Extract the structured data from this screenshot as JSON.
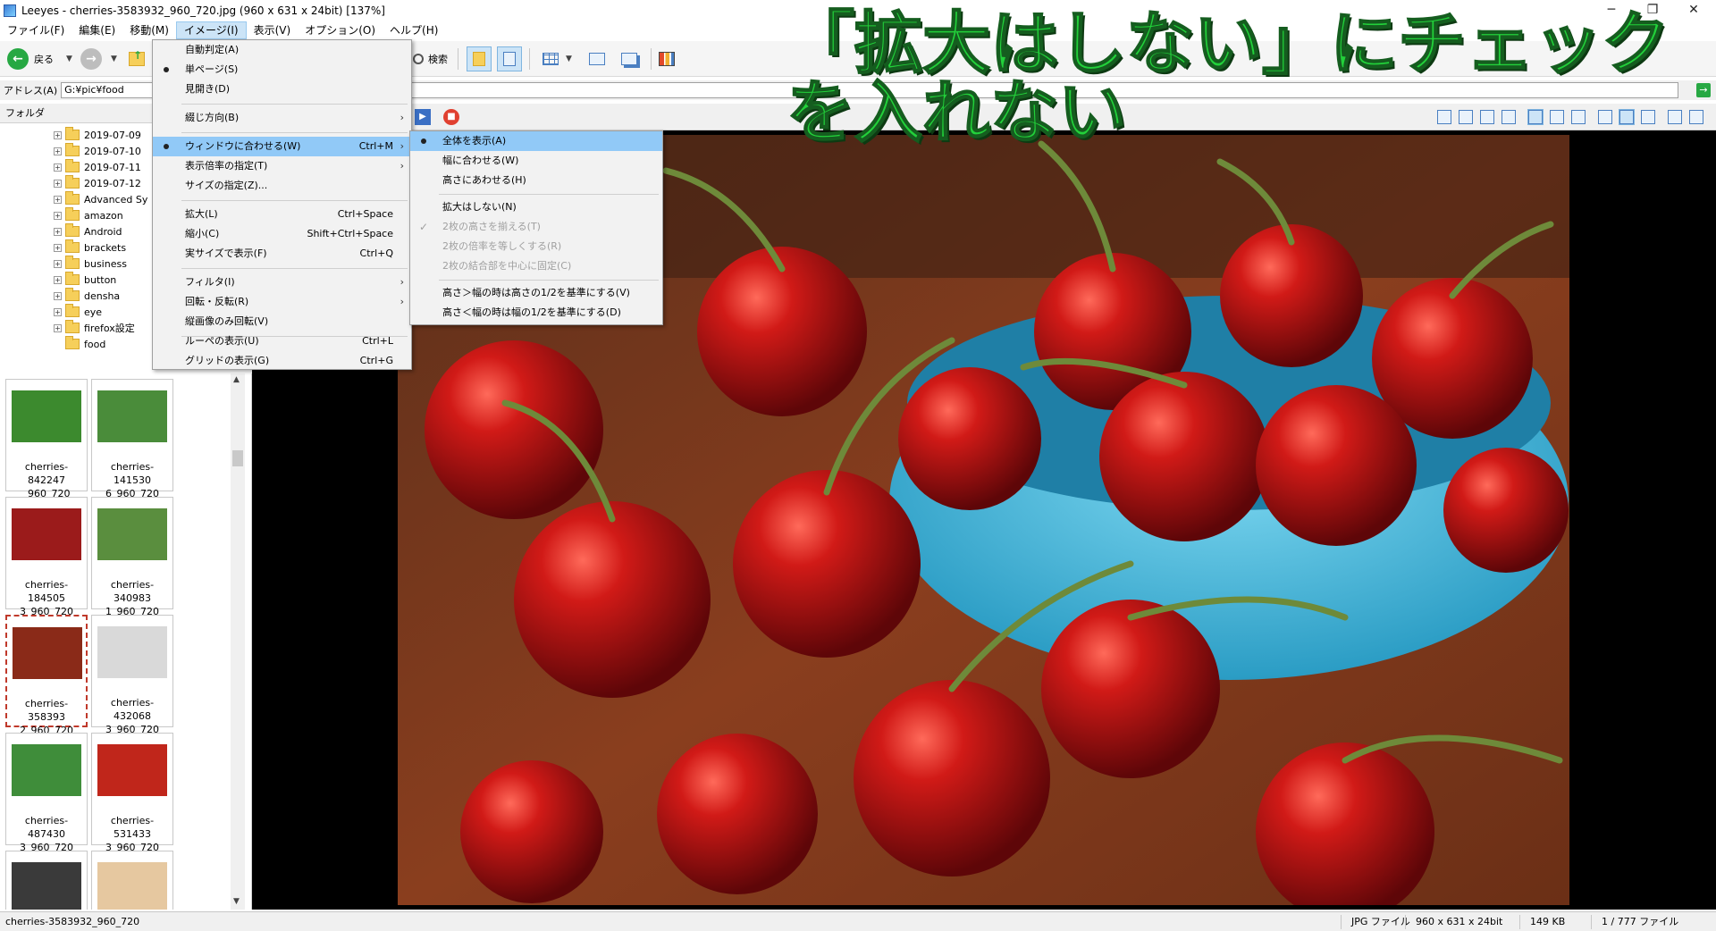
{
  "window": {
    "title": "Leeyes - cherries-3583932_960_720.jpg (960 x 631 x 24bit) [137%]",
    "minimize": "─",
    "maximize": "❐",
    "close": "✕"
  },
  "menubar": [
    "ファイル(F)",
    "編集(E)",
    "移動(M)",
    "イメージ(I)",
    "表示(V)",
    "オプション(O)",
    "ヘルプ(H)"
  ],
  "toolbar": {
    "back_label": "戻る",
    "search_label": "検索"
  },
  "address": {
    "label": "アドレス(A)",
    "value": "G:¥pic¥food"
  },
  "folder_pane": {
    "header": "フォルダ",
    "items": [
      "2019-07-09",
      "2019-07-10",
      "2019-07-11",
      "2019-07-12",
      "Advanced Sy",
      "amazon",
      "Android",
      "brackets",
      "business",
      "button",
      "densha",
      "eye",
      "firefox設定",
      "food"
    ]
  },
  "thumbnails": [
    {
      "label1": "cherries-842247",
      "label2": "_960_720",
      "color": "#3c8a2e"
    },
    {
      "label1": "cherries-141530",
      "label2": "6_960_720",
      "color": "#4a8c3a"
    },
    {
      "label1": "cherries-184505",
      "label2": "3_960_720",
      "color": "#9b1b1b"
    },
    {
      "label1": "cherries-340983",
      "label2": "1_960_720",
      "color": "#5a8e3e"
    },
    {
      "label1": "cherries-358393",
      "label2": "2_960_720",
      "color": "#8a2a18"
    },
    {
      "label1": "cherries-432068",
      "label2": "3_960_720",
      "color": "#d9d9d9"
    },
    {
      "label1": "cherries-487430",
      "label2": "3_960_720",
      "color": "#3f8d3a"
    },
    {
      "label1": "cherries-531433",
      "label2": "3_960_720",
      "color": "#c0261b"
    },
    {
      "label1": "",
      "label2": "",
      "color": "#3a3a3a"
    },
    {
      "label1": "",
      "label2": "",
      "color": "#e6c8a0"
    }
  ],
  "image_menu": {
    "items": [
      {
        "label": "自動判定(A)",
        "shortcut": "",
        "submenu": false,
        "bullet": false
      },
      {
        "label": "単ページ(S)",
        "shortcut": "",
        "submenu": false,
        "bullet": true
      },
      {
        "label": "見開き(D)",
        "shortcut": "",
        "submenu": false,
        "bullet": false
      },
      {
        "label": "綴じ方向(B)",
        "shortcut": "",
        "submenu": true,
        "bullet": false
      },
      {
        "label": "ウィンドウに合わせる(W)",
        "shortcut": "Ctrl+M",
        "submenu": true,
        "bullet": true
      },
      {
        "label": "表示倍率の指定(T)",
        "shortcut": "",
        "submenu": true,
        "bullet": false
      },
      {
        "label": "サイズの指定(Z)...",
        "shortcut": "",
        "submenu": false,
        "bullet": false
      },
      {
        "label": "拡大(L)",
        "shortcut": "Ctrl+Space",
        "submenu": false,
        "bullet": false
      },
      {
        "label": "縮小(C)",
        "shortcut": "Shift+Ctrl+Space",
        "submenu": false,
        "bullet": false
      },
      {
        "label": "実サイズで表示(F)",
        "shortcut": "Ctrl+Q",
        "submenu": false,
        "bullet": false
      },
      {
        "label": "フィルタ(I)",
        "shortcut": "",
        "submenu": true,
        "bullet": false
      },
      {
        "label": "回転・反転(R)",
        "shortcut": "",
        "submenu": true,
        "bullet": false
      },
      {
        "label": "縦画像のみ回転(V)",
        "shortcut": "",
        "submenu": false,
        "bullet": false
      },
      {
        "label": "ルーペの表示(U)",
        "shortcut": "Ctrl+L",
        "submenu": false,
        "bullet": false
      },
      {
        "label": "グリッドの表示(G)",
        "shortcut": "Ctrl+G",
        "submenu": false,
        "bullet": false
      }
    ]
  },
  "fit_submenu": {
    "items": [
      {
        "label": "全体を表示(A)",
        "bullet": true,
        "disabled": false,
        "check": false
      },
      {
        "label": "幅に合わせる(W)",
        "bullet": false,
        "disabled": false,
        "check": false
      },
      {
        "label": "高さにあわせる(H)",
        "bullet": false,
        "disabled": false,
        "check": false
      },
      {
        "label": "拡大はしない(N)",
        "bullet": false,
        "disabled": false,
        "check": false
      },
      {
        "label": "2枚の高さを揃える(T)",
        "bullet": false,
        "disabled": true,
        "check": true
      },
      {
        "label": "2枚の倍率を等しくする(R)",
        "bullet": false,
        "disabled": true,
        "check": false
      },
      {
        "label": "2枚の結合部を中心に固定(C)",
        "bullet": false,
        "disabled": true,
        "check": false
      },
      {
        "label": "高さ＞幅の時は高さの1/2を基準にする(V)",
        "bullet": false,
        "disabled": false,
        "check": false
      },
      {
        "label": "高さ＜幅の時は幅の1/2を基準にする(D)",
        "bullet": false,
        "disabled": false,
        "check": false
      }
    ]
  },
  "annotation": {
    "line1": "「拡大はしない」にチェック",
    "line2": "を入れない"
  },
  "statusbar": {
    "filename": "cherries-3583932_960_720",
    "type": "JPG ファイル",
    "dims": "960 x 631 x 24bit",
    "size": "149 KB",
    "count": "1 / 777 ファイル"
  },
  "colors": {
    "accent": "#91c9f7",
    "annotation": "#22d13a",
    "viewer_bg": "#000000"
  }
}
